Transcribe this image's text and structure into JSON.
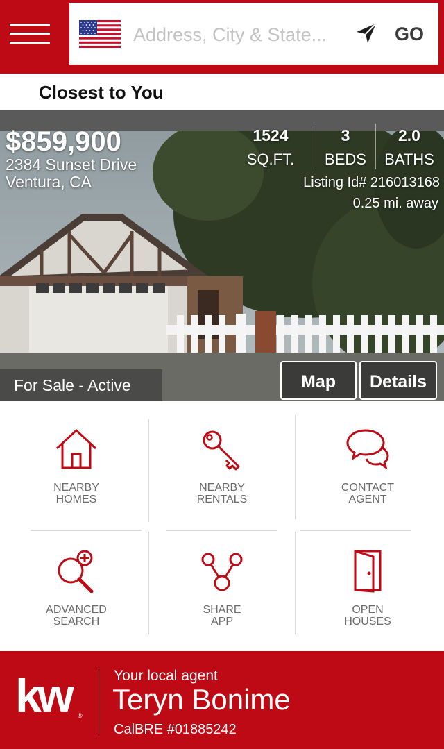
{
  "header": {
    "search_placeholder": "Address, City & State...",
    "go_label": "GO",
    "brand_color": "#be0a14"
  },
  "section": {
    "title": "Closest to You"
  },
  "listing": {
    "price": "$859,900",
    "address_line1": "2384 Sunset Drive",
    "address_line2": "Ventura, CA",
    "stats": [
      {
        "value": "1524",
        "label": "SQ.FT."
      },
      {
        "value": "3",
        "label": "BEDS"
      },
      {
        "value": "2.0",
        "label": "BATHS"
      }
    ],
    "listing_id": "Listing Id# 216013168",
    "distance": "0.25 mi.  away",
    "status": "For Sale - Active",
    "map_label": "Map",
    "details_label": "Details"
  },
  "actions": [
    {
      "line1": "NEARBY",
      "line2": "HOMES",
      "icon": "house-icon"
    },
    {
      "line1": "NEARBY",
      "line2": "RENTALS",
      "icon": "key-icon"
    },
    {
      "line1": "CONTACT",
      "line2": "AGENT",
      "icon": "chat-bubbles-icon"
    },
    {
      "line1": "ADVANCED",
      "line2": "SEARCH",
      "icon": "magnifier-plus-icon"
    },
    {
      "line1": "SHARE",
      "line2": "APP",
      "icon": "share-nodes-icon"
    },
    {
      "line1": "OPEN",
      "line2": "HOUSES",
      "icon": "open-door-icon"
    }
  ],
  "footer": {
    "logo_text": "kw",
    "logo_mark": "®",
    "caption": "Your local agent",
    "agent_name": "Teryn Bonime",
    "license": "CalBRE #01885242"
  }
}
